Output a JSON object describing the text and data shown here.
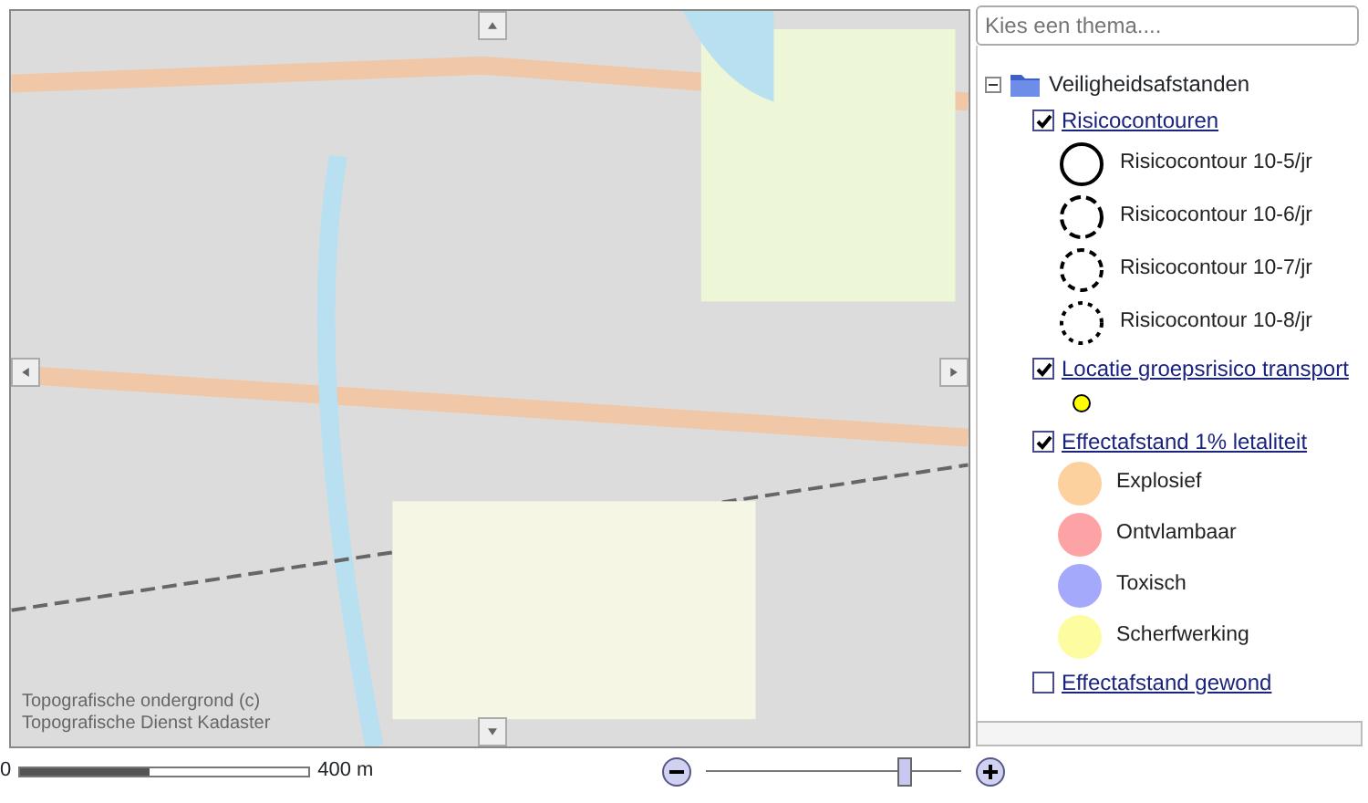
{
  "map": {
    "attribution": [
      "Topografische ondergrond (c)",
      "Topografische Dienst Kadaster"
    ],
    "scale": {
      "start": "0",
      "end": "400 m",
      "level": 0.45
    },
    "zoom": {
      "level": 0.78
    }
  },
  "theme_select": {
    "placeholder": "Kies een thema...."
  },
  "tree": {
    "label": "Veiligheidsafstanden",
    "expanded": true,
    "children": [
      {
        "label": "Risicocontouren",
        "checked": true,
        "legend": [
          {
            "kind": "solid",
            "label": "Risicocontour 10-5/jr"
          },
          {
            "kind": "longdash",
            "label": "Risicocontour 10-6/jr"
          },
          {
            "kind": "dash",
            "label": "Risicocontour 10-7/jr"
          },
          {
            "kind": "dot",
            "label": "Risicocontour 10-8/jr"
          }
        ]
      },
      {
        "label": "Locatie groepsrisico transport",
        "checked": true,
        "legend": [
          {
            "kind": "marker",
            "color": "#ffff00"
          }
        ]
      },
      {
        "label": "Effectafstand 1% letaliteit",
        "checked": true,
        "legend": [
          {
            "kind": "area",
            "color": "#fdd19e",
            "label": "Explosief"
          },
          {
            "kind": "area",
            "color": "#fea3a5",
            "label": "Ontvlambaar"
          },
          {
            "kind": "area",
            "color": "#a5a9fb",
            "label": "Toxisch"
          },
          {
            "kind": "area",
            "color": "#fefca0",
            "label": "Scherfwerking"
          }
        ]
      },
      {
        "label": "Effectafstand gewond",
        "checked": false
      }
    ]
  }
}
